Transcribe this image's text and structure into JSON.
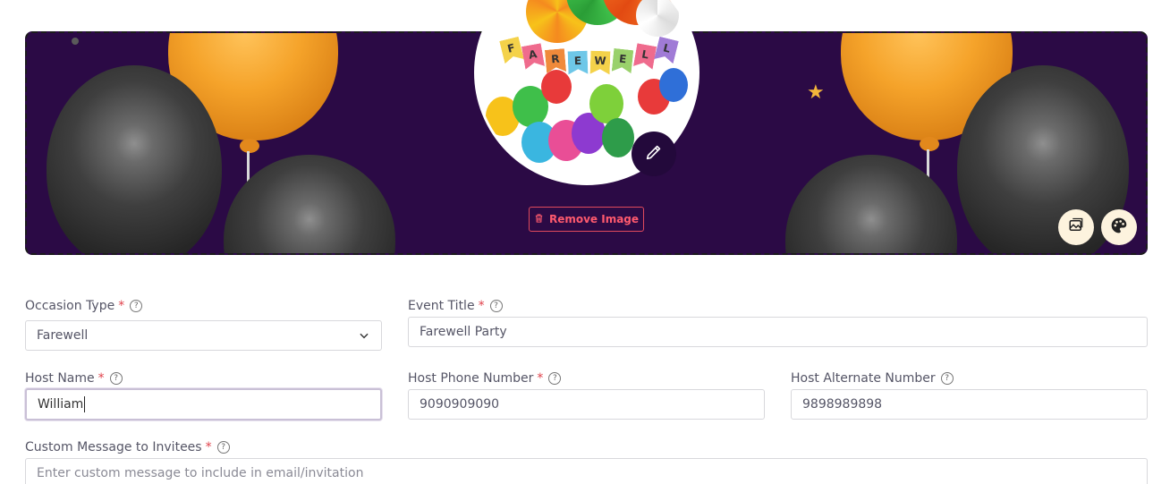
{
  "banner": {
    "remove_image_label": "Remove Image",
    "avatar_flag_letters": [
      "F",
      "A",
      "R",
      "E",
      "W",
      "E",
      "L",
      "L"
    ],
    "colors": {
      "background": "#2b0a45",
      "accent_remove": "#e04a5c"
    }
  },
  "form": {
    "occasion_type": {
      "label": "Occasion Type",
      "value": "Farewell"
    },
    "event_title": {
      "label": "Event Title",
      "value": "Farewell Party"
    },
    "host_name": {
      "label": "Host Name",
      "value": "William"
    },
    "host_phone": {
      "label": "Host Phone Number",
      "value": "9090909090"
    },
    "host_alt_phone": {
      "label": "Host Alternate Number",
      "value": "9898989898"
    },
    "custom_message": {
      "label": "Custom Message to Invitees",
      "placeholder": "Enter custom message to include in email/invitation"
    },
    "required_mark": "*",
    "help_glyph": "?"
  },
  "icons": [
    "pencil-icon",
    "trash-icon",
    "image-icon",
    "palette-icon",
    "chevron-down-icon",
    "help-circle-icon"
  ]
}
